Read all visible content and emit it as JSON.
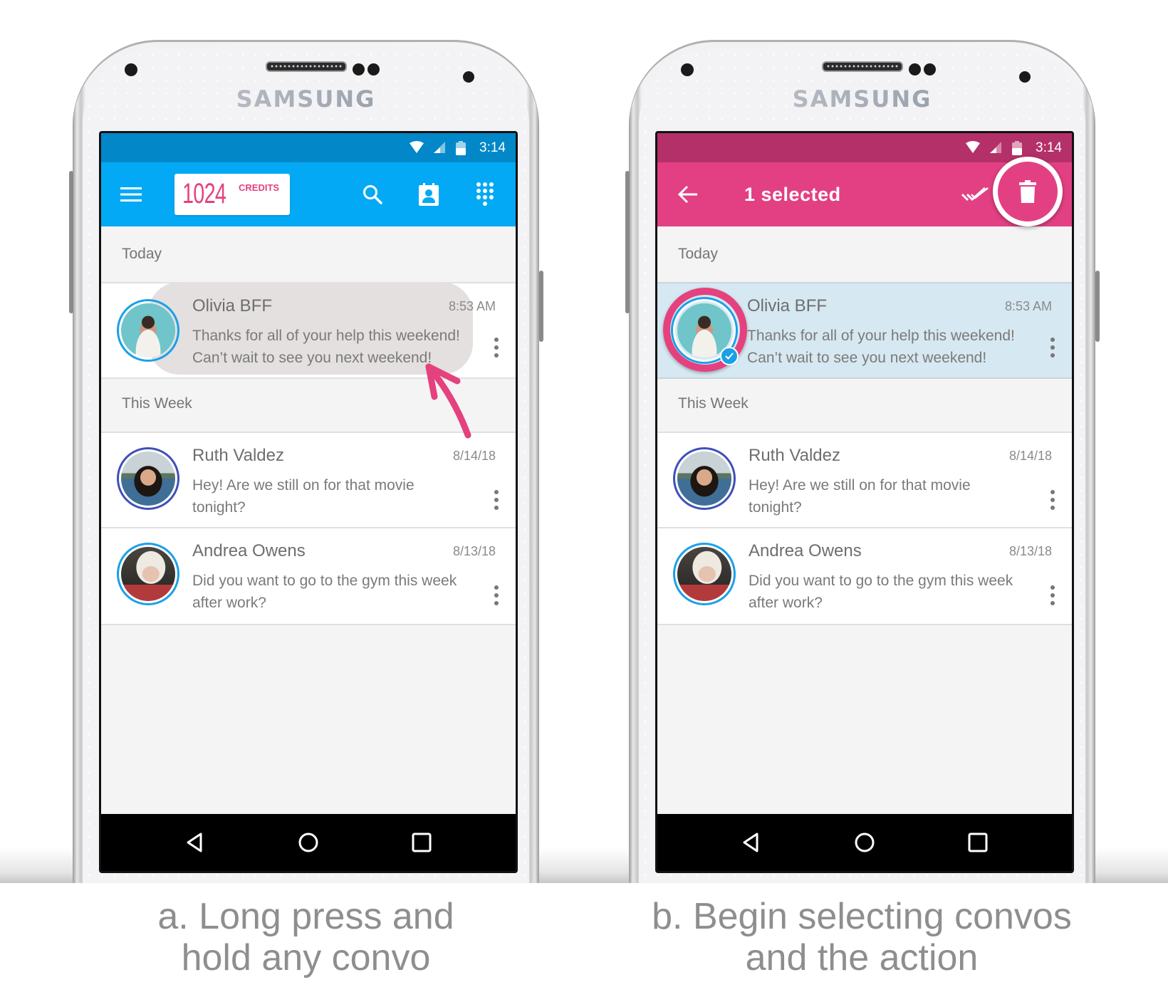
{
  "device_brand": "SAMSUNG",
  "colors": {
    "blue_status": "#0288c9",
    "blue_toolbar": "#03a9f4",
    "pink_status": "#b43068",
    "pink_toolbar": "#e34083",
    "pink_accent": "#e4417f",
    "selected_row": "#d6e8f1",
    "caption_gray": "#8e8e8e"
  },
  "panels": [
    {
      "id": "a",
      "status_bar": {
        "time": "3:14",
        "icons": [
          "wifi-icon",
          "signal-icon",
          "battery-icon"
        ]
      },
      "toolbar": {
        "menu_icon": "hamburger-menu-icon",
        "credits_value": "1024",
        "credits_label": "CREDITS",
        "actions": [
          "search-icon",
          "contacts-icon",
          "dialpad-icon"
        ]
      },
      "sections": [
        {
          "label": "Today"
        },
        {
          "label": "This Week"
        }
      ],
      "conversations": [
        {
          "name": "Olivia BFF",
          "time": "8:53 AM",
          "message": "Thanks for all of your help this weekend! Can’t wait to see you next weekend!",
          "pressed": true
        },
        {
          "name": "Ruth Valdez",
          "time": "8/14/18",
          "message": "Hey! Are we still on for that movie tonight?"
        },
        {
          "name": "Andrea Owens",
          "time": "8/13/18",
          "message": "Did you want to go to the gym this week after work?"
        }
      ],
      "caption": [
        "a. Long press and",
        "hold any convo"
      ]
    },
    {
      "id": "b",
      "status_bar": {
        "time": "3:14",
        "icons": [
          "wifi-icon",
          "signal-icon",
          "battery-icon"
        ]
      },
      "toolbar": {
        "back_icon": "back-arrow-icon",
        "title": "1 selected",
        "actions": [
          "select-all-icon",
          "delete-icon"
        ]
      },
      "sections": [
        {
          "label": "Today"
        },
        {
          "label": "This Week"
        }
      ],
      "conversations": [
        {
          "name": "Olivia BFF",
          "time": "8:53 AM",
          "message": "Thanks for all of your help this weekend! Can’t wait to see you next weekend!",
          "selected": true
        },
        {
          "name": "Ruth Valdez",
          "time": "8/14/18",
          "message": "Hey! Are we still on for that movie tonight?"
        },
        {
          "name": "Andrea Owens",
          "time": "8/13/18",
          "message": "Did you want to go to the gym this week after work?"
        }
      ],
      "caption": [
        "b. Begin selecting convos",
        "and the action"
      ]
    }
  ],
  "nav_bar": [
    "back-nav-icon",
    "home-nav-icon",
    "recents-nav-icon"
  ]
}
